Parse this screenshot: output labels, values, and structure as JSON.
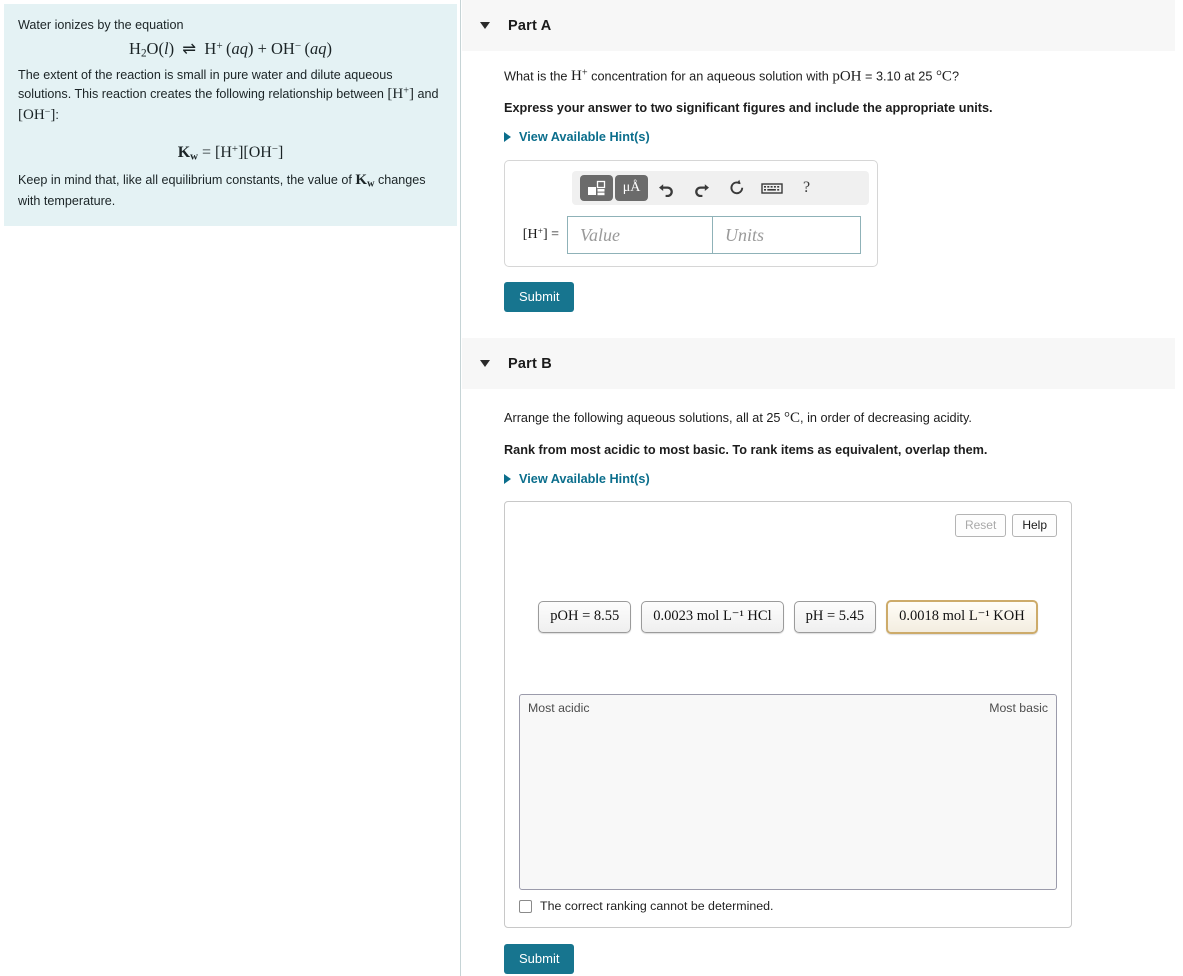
{
  "intro": {
    "line1": "Water ionizes by the equation",
    "equation_ionization": "H₂O(l) ⇌ H⁺(aq) + OH⁻(aq)",
    "line2_a": "The extent of the reaction is small in pure water and dilute aqueous solutions. This reaction creates the following relationship between ",
    "line2_h": "[H⁺]",
    "line2_b": " and ",
    "line2_oh": "[OH⁻]",
    "line2_c": ":",
    "equation_kw": "Kw = [H⁺][OH⁻]",
    "line3_a": "Keep in mind that, like all equilibrium constants, the value of ",
    "line3_kw": "Kw",
    "line3_b": " changes with temperature."
  },
  "part_a": {
    "title": "Part A",
    "caret_icon": "caret-down-icon",
    "question_pre": "What is the ",
    "question_species": "H⁺",
    "question_mid": " concentration for an aqueous solution with ",
    "question_poh": "pOH",
    "question_eq": " = 3.10 at 25 ",
    "question_temp": "°C",
    "question_end": "?",
    "instruction": "Express your answer to two significant figures and include the appropriate units.",
    "hint_label": "View Available Hint(s)",
    "toolbar": [
      {
        "name": "template-builder-icon",
        "label": ""
      },
      {
        "name": "units-micro-angstrom-icon",
        "label": "μÅ"
      },
      {
        "name": "undo-icon",
        "label": ""
      },
      {
        "name": "redo-icon",
        "label": ""
      },
      {
        "name": "reset-icon",
        "label": ""
      },
      {
        "name": "keyboard-icon",
        "label": ""
      },
      {
        "name": "help-icon",
        "label": "?"
      }
    ],
    "answer_var_label": "[H⁺] =",
    "value_placeholder": "Value",
    "units_placeholder": "Units",
    "submit_label": "Submit"
  },
  "part_b": {
    "title": "Part B",
    "caret_icon": "caret-down-icon",
    "question_pre": "Arrange the following aqueous solutions, all at 25 ",
    "question_temp": "°C",
    "question_post": ", in order of decreasing acidity.",
    "instruction": "Rank from most acidic to most basic. To rank items as equivalent, overlap them.",
    "hint_label": "View Available Hint(s)",
    "reset_label": "Reset",
    "help_label": "Help",
    "tiles": [
      {
        "text": "pOH = 8.55",
        "highlighted": false
      },
      {
        "text": "0.0023 mol L⁻¹ HCl",
        "highlighted": false
      },
      {
        "text": "pH = 5.45",
        "highlighted": false
      },
      {
        "text": "0.0018 mol L⁻¹ KOH",
        "highlighted": true
      }
    ],
    "dropzone_left_label": "Most acidic",
    "dropzone_right_label": "Most basic",
    "cannot_determine_label": "The correct ranking cannot be determined.",
    "submit_label": "Submit"
  },
  "colors": {
    "intro_background": "#e4f2f4",
    "submit_teal": "#17758f",
    "hint_link": "#0b6e8c",
    "part_header_background": "#f7f7f7",
    "tile_highlight_border": "#cdab6a",
    "input_border": "#8fb2b8"
  }
}
